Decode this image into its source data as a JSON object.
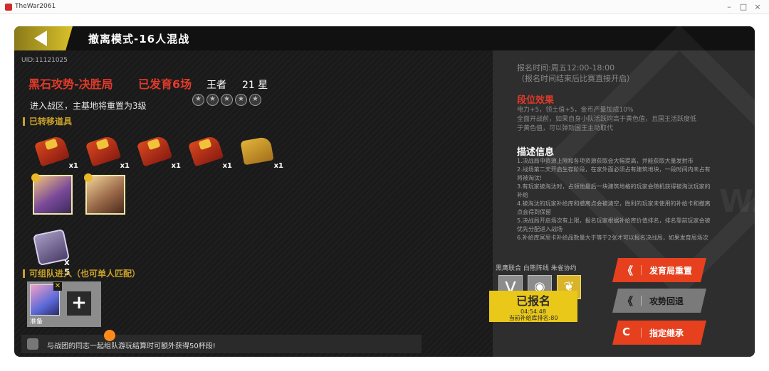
{
  "window": {
    "title": "TheWar2061",
    "minimize": "–",
    "maximize": "□",
    "close": "×"
  },
  "header": {
    "mode_title": "撤离模式-16人混战"
  },
  "uid": "UID:11121025",
  "result": {
    "title": "黑石攻势-决胜局",
    "dev_count": "已发育6场",
    "rank": "王者",
    "stars_text": "21 星",
    "star_icons": 5,
    "hq_note": "进入战区，主基地将重置为3级"
  },
  "carried": {
    "heading": "已转移道具",
    "items": [
      {
        "icon": "red-tank-icon",
        "qty": "x1"
      },
      {
        "icon": "red-tank-icon",
        "qty": "x1"
      },
      {
        "icon": "red-tank-icon",
        "qty": "x1"
      },
      {
        "icon": "red-tank-icon",
        "qty": "x1"
      },
      {
        "icon": "gold-tank-icon",
        "qty": "x1"
      }
    ],
    "supply_qty": "x 5"
  },
  "team": {
    "heading": "可组队进入（也可单人匹配）",
    "ready_label": "准备",
    "add_label": "+",
    "remove_label": "✕"
  },
  "bottom_tip": "与战团的同志一起组队游玩结算时可额外获得50杯段!",
  "info": {
    "signup_time": "报名时间:周五12:00-18:00",
    "signup_note": "（报名时间结束后比赛直接开启）",
    "effect_heading": "段位效果",
    "effect_line1": "电力+5，领土值+5，金币产量加成10%",
    "effect_line2": "全面开战前，如果自身小队活跃均高于黄色值，且国王活跃度低",
    "effect_line3": "于黄色值，可以弹劾国王主动取代",
    "desc_heading": "描述信息",
    "desc_lines": [
      "1.决战局中资源上限和各项资源获取会大幅提高，并能获取大量发射币",
      "2.战场第二天开启生存阶段，在家外面必须占有建筑地块，一段时间内未占有",
      "将被淘汰!",
      "3.有玩家被淘汰时，占领他最后一块建筑地格的玩家会随机获得被淘汰玩家的",
      "补给",
      "4.被淘汰的玩家补给库和撤离点会被清空，胜利的玩家未使用的补给卡和撤离",
      "点会得到保留",
      "5.决战局开启场次有上限，报名玩家根据补给库价值排名，排名靠前玩家会被",
      "优先分配进入战场",
      "6.补给库冥思卡补给品数量大于等于2张才可以报名决战局，如果发育局场次"
    ],
    "watermark": "WAR"
  },
  "factions": {
    "labels": "黑鹰联合 白熊阵线 朱雀协约",
    "items": [
      {
        "icon": "eagle-faction-icon",
        "glyph": "⋁"
      },
      {
        "icon": "bear-faction-icon",
        "glyph": "◉"
      },
      {
        "icon": "phoenix-faction-icon",
        "glyph": "❦"
      }
    ]
  },
  "status": {
    "main": "已报名",
    "time": "04:54:48",
    "rank_text": "当前补给库排名:80"
  },
  "actions": {
    "reset": {
      "label": "发育局重置",
      "icon": "《"
    },
    "retreat": {
      "label": "攻势回退",
      "icon": "《"
    },
    "designate": {
      "label": "指定继承",
      "icon": "C"
    }
  },
  "colors": {
    "accent_red": "#e23a2a",
    "accent_gold": "#c9a12a",
    "status_yellow": "#e9c81a",
    "button_red": "#e6401e"
  }
}
